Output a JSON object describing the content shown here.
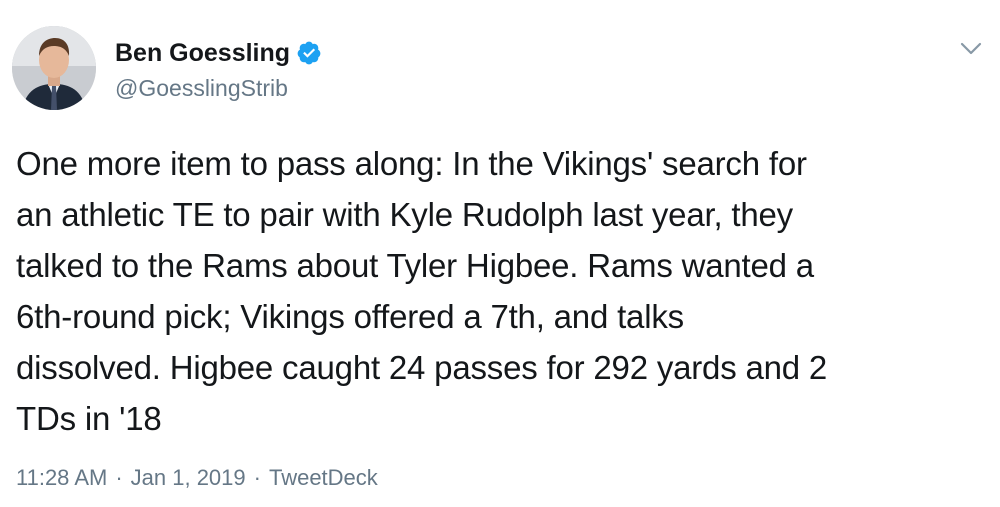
{
  "author": {
    "display_name": "Ben Goessling",
    "handle": "@GoesslingStrib",
    "verified": true,
    "avatar_icon": "profile-photo"
  },
  "menu": {
    "icon": "chevron-down-icon"
  },
  "tweet": {
    "text": "One more item to pass along: In the Vikings' search for\nan athletic TE to pair with Kyle Rudolph last year, they\ntalked to the Rams about Tyler Higbee. Rams wanted a\n6th-round pick; Vikings offered a 7th, and talks\ndissolved. Higbee caught 24 passes for 292 yards and 2\nTDs in '18"
  },
  "meta": {
    "time": "11:28 AM",
    "date": "Jan 1, 2019",
    "source": "TweetDeck",
    "separator": "·"
  },
  "colors": {
    "text": "#14171a",
    "secondary": "#657786",
    "verified_blue": "#1da1f2"
  }
}
